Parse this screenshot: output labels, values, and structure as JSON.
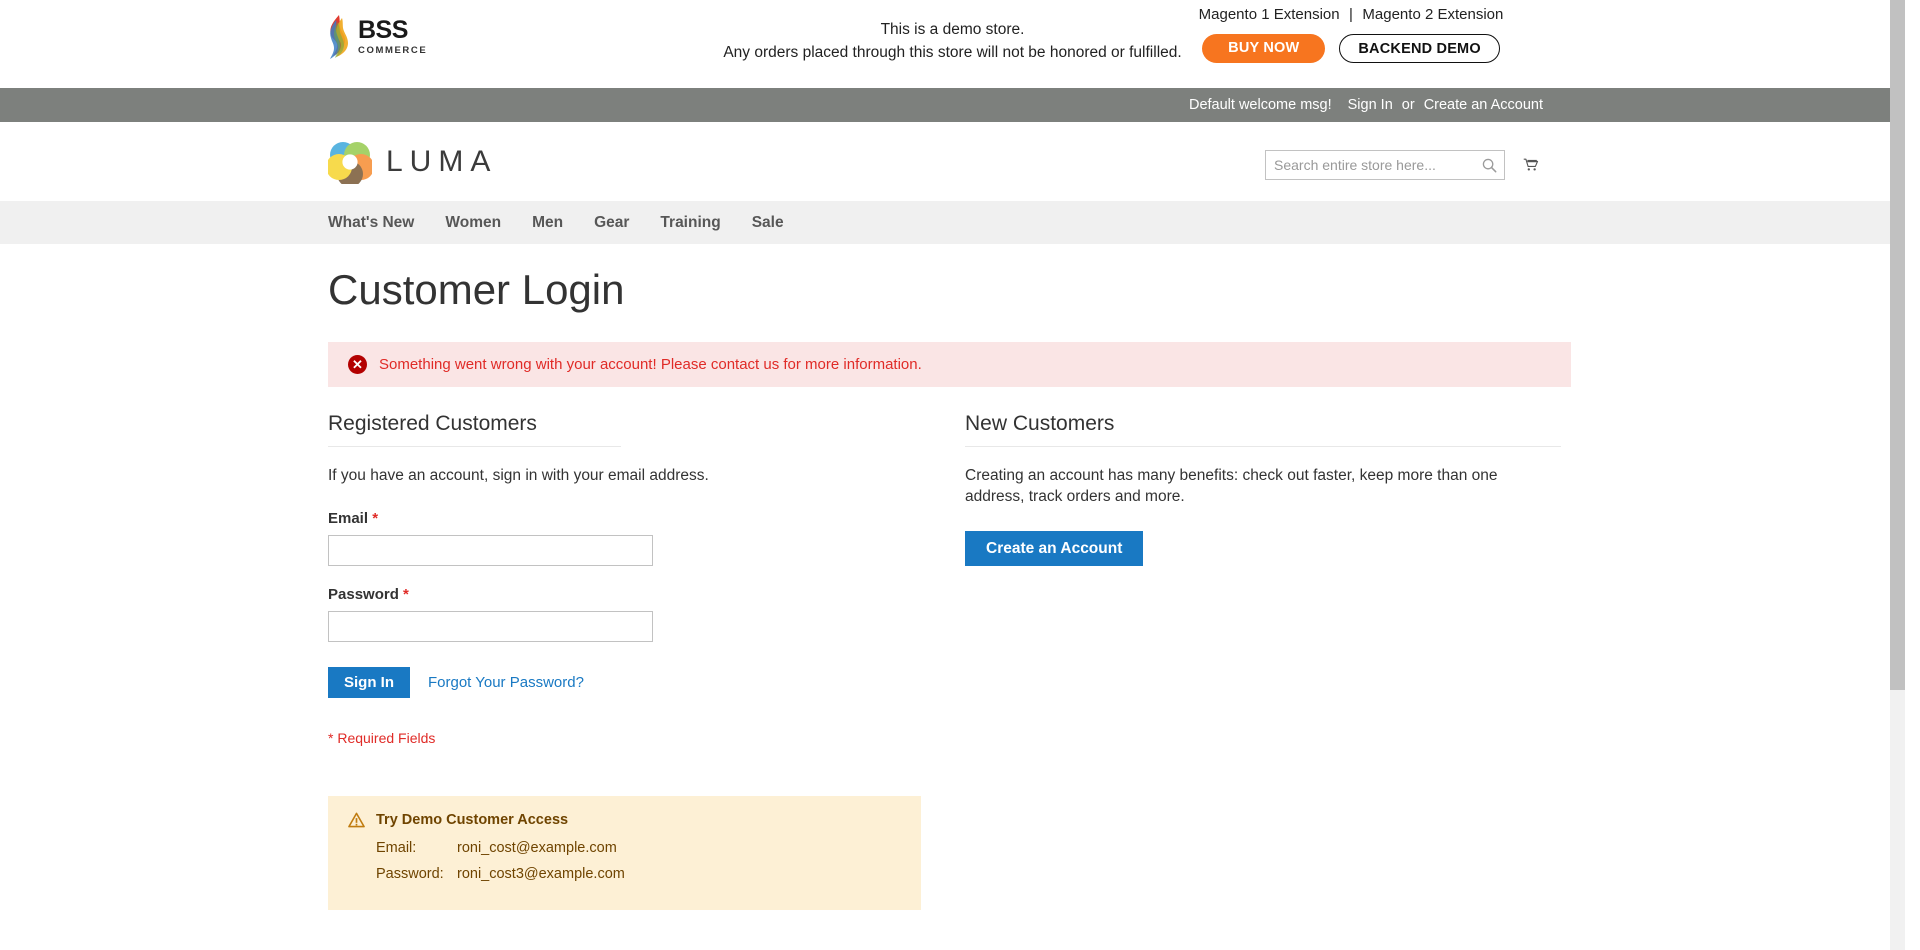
{
  "demo_banner": {
    "logo": {
      "name": "BSS",
      "subtitle": "COMMERCE"
    },
    "message_line1": "This is a demo store.",
    "message_line2": "Any orders placed through this store will not be honored or fulfilled.",
    "ext_link_1": "Magento 1 Extension",
    "ext_separator": "|",
    "ext_link_2": "Magento 2 Extension",
    "buy_now_label": "BUY NOW",
    "backend_demo_label": "BACKEND DEMO",
    "buy_now_color": "#f7751f"
  },
  "welcome": {
    "message": "Default welcome msg!",
    "sign_in": "Sign In",
    "or": "or",
    "create_account": "Create an Account"
  },
  "header": {
    "brand": "LUMA",
    "search_placeholder": "Search entire store here...",
    "search_value": "",
    "search_icon": "search-icon",
    "cart_icon": "shopping-cart-icon"
  },
  "nav": {
    "items": [
      {
        "label": "What's New"
      },
      {
        "label": "Women"
      },
      {
        "label": "Men"
      },
      {
        "label": "Gear"
      },
      {
        "label": "Training"
      },
      {
        "label": "Sale"
      }
    ]
  },
  "main": {
    "title": "Customer Login",
    "error": {
      "icon": "error-circle-icon",
      "message": "Something went wrong with your account! Please contact us for more information.",
      "bg_color": "#fae5e5",
      "text_color": "#e02b27"
    },
    "registered": {
      "heading": "Registered Customers",
      "lead": "If you have an account, sign in with your email address.",
      "email_label": "Email",
      "email_required": "*",
      "email_value": "",
      "password_label": "Password",
      "password_required": "*",
      "password_value": "",
      "sign_in_label": "Sign In",
      "forgot_password_label": "Forgot Your Password?",
      "required_note": "* Required Fields"
    },
    "new_customers": {
      "heading": "New Customers",
      "lead": "Creating an account has many benefits: check out faster, keep more than one address, track orders and more.",
      "create_account_label": "Create an Account"
    },
    "demo_access": {
      "icon": "warning-triangle-icon",
      "title": "Try Demo Customer Access",
      "email_key": "Email:",
      "email_value": "roni_cost@example.com",
      "password_key": "Password:",
      "password_value": "roni_cost3@example.com",
      "bg_color": "#fdf0d5"
    }
  }
}
